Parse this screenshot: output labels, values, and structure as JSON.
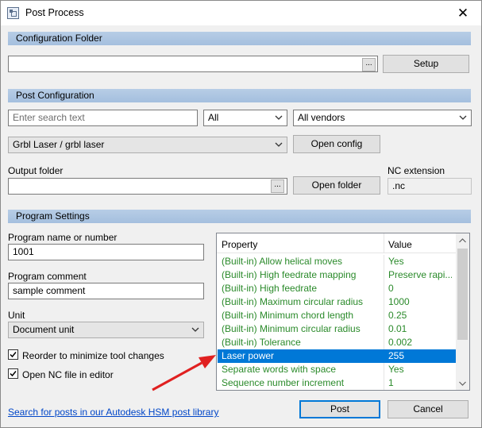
{
  "window": {
    "title": "Post Process"
  },
  "config_folder": {
    "section_title": "Configuration Folder",
    "path_value": "",
    "browse_label": "...",
    "setup_label": "Setup"
  },
  "post_config": {
    "section_title": "Post Configuration",
    "search_placeholder": "Enter search text",
    "filter_value": "All",
    "vendor_value": "All vendors",
    "post_value": "Grbl Laser / grbl laser",
    "open_config_label": "Open config",
    "output_folder_label": "Output folder",
    "output_folder_value": "",
    "output_browse_label": "...",
    "open_folder_label": "Open folder",
    "nc_extension_label": "NC extension",
    "nc_extension_value": ".nc"
  },
  "program_settings": {
    "section_title": "Program Settings",
    "program_name_label": "Program name or number",
    "program_name_value": "1001",
    "program_comment_label": "Program comment",
    "program_comment_value": "sample comment",
    "unit_label": "Unit",
    "unit_value": "Document unit",
    "reorder_label": "Reorder to minimize tool changes",
    "reorder_checked": true,
    "open_nc_label": "Open NC file in editor",
    "open_nc_checked": true
  },
  "property_grid": {
    "headers": {
      "property": "Property",
      "value": "Value"
    },
    "rows": [
      {
        "property": "(Built-in) Allow helical moves",
        "value": "Yes",
        "selected": false
      },
      {
        "property": "(Built-in) High feedrate mapping",
        "value": "Preserve rapi...",
        "selected": false
      },
      {
        "property": "(Built-in) High feedrate",
        "value": "0",
        "selected": false
      },
      {
        "property": "(Built-in) Maximum circular radius",
        "value": "1000",
        "selected": false
      },
      {
        "property": "(Built-in) Minimum chord length",
        "value": "0.25",
        "selected": false
      },
      {
        "property": "(Built-in) Minimum circular radius",
        "value": "0.01",
        "selected": false
      },
      {
        "property": "(Built-in) Tolerance",
        "value": "0.002",
        "selected": false
      },
      {
        "property": "Laser power",
        "value": "255",
        "selected": true
      },
      {
        "property": "Separate words with space",
        "value": "Yes",
        "selected": false
      },
      {
        "property": "Sequence number increment",
        "value": "1",
        "selected": false
      }
    ]
  },
  "footer": {
    "library_link": "Search for posts in our Autodesk HSM post library",
    "post_label": "Post",
    "cancel_label": "Cancel"
  },
  "colors": {
    "section_bar": "#a4bfde",
    "builtin_text": "#2a8a2a",
    "selection": "#0078d7",
    "annotation_arrow": "#e02020",
    "link": "#0046c8"
  }
}
